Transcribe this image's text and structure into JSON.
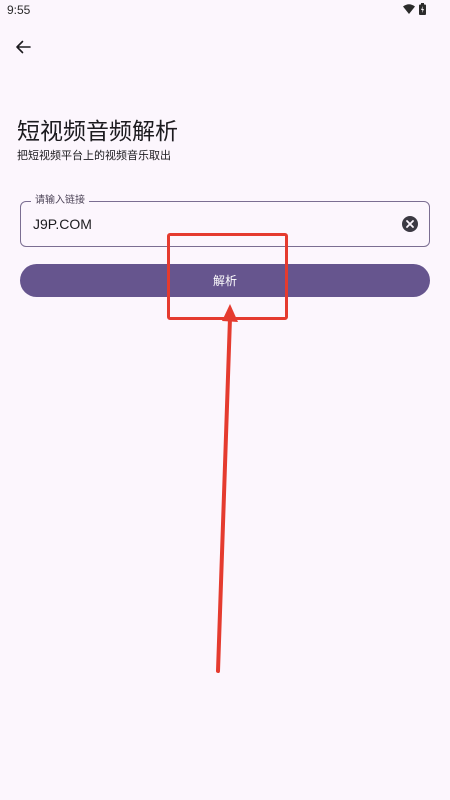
{
  "status_bar": {
    "time": "9:55",
    "icons": [
      "wifi-icon",
      "battery-icon"
    ]
  },
  "header": {
    "back_icon": "arrow-left-icon"
  },
  "main": {
    "title": "短视频音频解析",
    "subtitle": "把短视频平台上的视频音乐取出",
    "url_field": {
      "label": "请输入链接",
      "value": "J9P.COM",
      "clear_icon": "clear-circle-icon"
    },
    "parse_button_label": "解析"
  },
  "annotations": {
    "highlight_color": "#e53b2f"
  },
  "colors": {
    "background": "#fcf6fd",
    "accent": "#66558e",
    "field_border": "#7b6e92"
  }
}
